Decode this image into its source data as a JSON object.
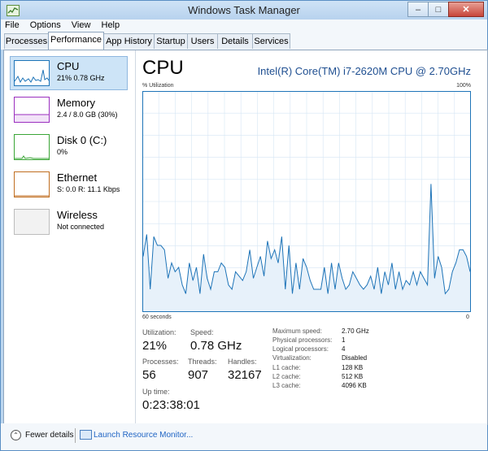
{
  "window": {
    "title": "Windows Task Manager"
  },
  "menu": [
    "File",
    "Options",
    "View",
    "Help"
  ],
  "tabs": [
    "Processes",
    "Performance",
    "App History",
    "Startup",
    "Users",
    "Details",
    "Services"
  ],
  "active_tab": "Performance",
  "sidebar": [
    {
      "name": "CPU",
      "sub": "21% 0.78 GHz",
      "color": "#1e74b8",
      "selected": true
    },
    {
      "name": "Memory",
      "sub": "2.4 / 8.0 GB (30%)",
      "color": "#9b2fbf",
      "selected": false
    },
    {
      "name": "Disk 0 (C:)",
      "sub": "0%",
      "color": "#3aa536",
      "selected": false
    },
    {
      "name": "Ethernet",
      "sub": "S: 0.0 R: 11.1 Kbps",
      "color": "#c06e20",
      "selected": false
    },
    {
      "name": "Wireless",
      "sub": "Not connected",
      "color": "#bdbdbd",
      "selected": false
    }
  ],
  "main": {
    "title": "CPU",
    "model": "Intel(R) Core(TM) i7-2620M CPU @ 2.70GHz",
    "util_label": "% Utilization",
    "util_max": "100%",
    "time_left": "60 seconds",
    "time_right": "0"
  },
  "stats": {
    "utilization_label": "Utilization:",
    "utilization": "21%",
    "speed_label": "Speed:",
    "speed": "0.78 GHz",
    "processes_label": "Processes:",
    "processes": "56",
    "threads_label": "Threads:",
    "threads": "907",
    "handles_label": "Handles:",
    "handles": "32167",
    "uptime_label": "Up time:",
    "uptime": "0:23:38:01"
  },
  "specs": [
    {
      "label": "Maximum speed:",
      "value": "2.70 GHz"
    },
    {
      "label": "Physical processors:",
      "value": "1"
    },
    {
      "label": "Logical processors:",
      "value": "4"
    },
    {
      "label": "Virtualization:",
      "value": "Disabled"
    },
    {
      "label": "L1 cache:",
      "value": "128 KB"
    },
    {
      "label": "L2 cache:",
      "value": "512 KB"
    },
    {
      "label": "L3 cache:",
      "value": "4096 KB"
    }
  ],
  "footer": {
    "fewer": "Fewer details",
    "monitor": "Launch Resource Monitor..."
  },
  "colors": {
    "accent": "#1e74b8",
    "graph_fill": "#e7f1fa",
    "graph_grid": "#d5e6f4"
  },
  "cpu_history": [
    25,
    35,
    10,
    34,
    30,
    30,
    28,
    15,
    22,
    18,
    20,
    12,
    8,
    22,
    14,
    20,
    8,
    26,
    15,
    10,
    18,
    18,
    22,
    20,
    12,
    10,
    18,
    16,
    14,
    18,
    28,
    15,
    20,
    25,
    16,
    32,
    24,
    28,
    22,
    34,
    10,
    30,
    8,
    22,
    10,
    24,
    20,
    14,
    10,
    10,
    10,
    20,
    8,
    22,
    10,
    22,
    15,
    10,
    12,
    18,
    15,
    12,
    10,
    12,
    16,
    10,
    20,
    8,
    18,
    12,
    22,
    10,
    18,
    10,
    14,
    12,
    18,
    12,
    18,
    15,
    12,
    58,
    15,
    25,
    20,
    8,
    10,
    18,
    22,
    28,
    28,
    25,
    18
  ]
}
